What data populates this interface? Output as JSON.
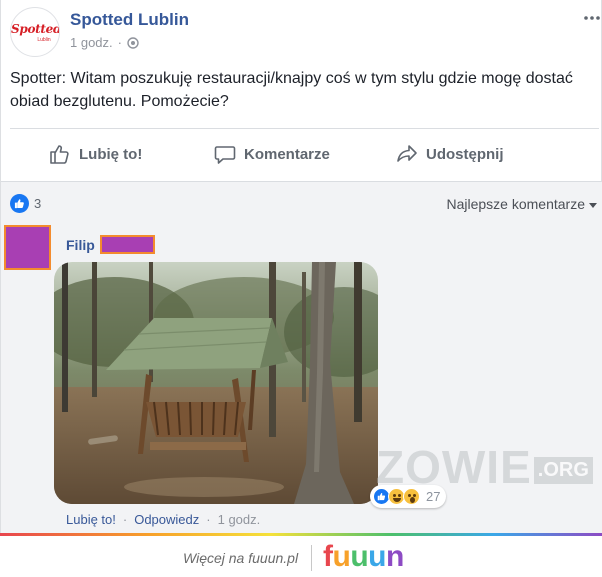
{
  "post": {
    "page_name": "Spotted Lublin",
    "avatar_logo": "Spotted",
    "avatar_sub": "Lublin",
    "timestamp": "1 godz.",
    "separator": "·",
    "more_icon": "more-horizontal-icon",
    "text": "Spotter: Witam poszukuję restauracji/knajpy coś w tym stylu gdzie mogę dostać obiad bezglutenu. Pomożecie?"
  },
  "actions": {
    "like": "Lubię to!",
    "comment": "Komentarze",
    "share": "Udostępnij"
  },
  "comments": {
    "reaction_count": "3",
    "sort_label": "Najlepsze komentarze",
    "items": [
      {
        "author": "Filip",
        "image_alt": "forest-feeder-photo",
        "reactions_count": "27",
        "like_label": "Lubię to!",
        "reply_label": "Odpowiedz",
        "time": "1 godz."
      }
    ]
  },
  "watermark": {
    "text": "ZOWIE",
    "suffix": ".ORG"
  },
  "footer": {
    "text": "Więcej na fuuun.pl",
    "logo_letters": [
      "f",
      "u",
      "u",
      "u",
      "n"
    ],
    "logo_colors": [
      "#e8464e",
      "#f7a12a",
      "#4cbf6b",
      "#3aa7e8",
      "#8d4bc4"
    ]
  },
  "colors": {
    "facebook_blue": "#365899",
    "like_blue": "#1877f2",
    "redaction_purple": "#a83fb3",
    "redaction_border": "#f38b2e"
  }
}
